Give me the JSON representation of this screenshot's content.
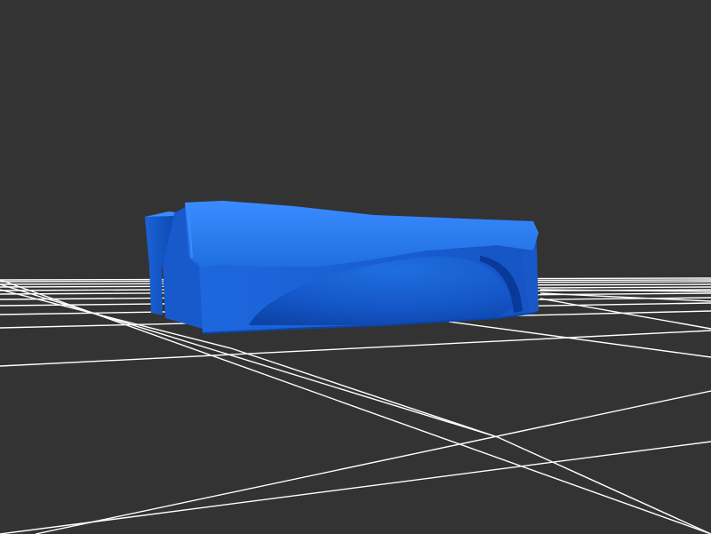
{
  "viewer": {
    "background_color": "#333333",
    "grid_color": "#ffffff",
    "model_color": "#1f6fe0",
    "model_shadow_color": "#0a3fa8",
    "model_highlight_color": "#3b8cff"
  }
}
